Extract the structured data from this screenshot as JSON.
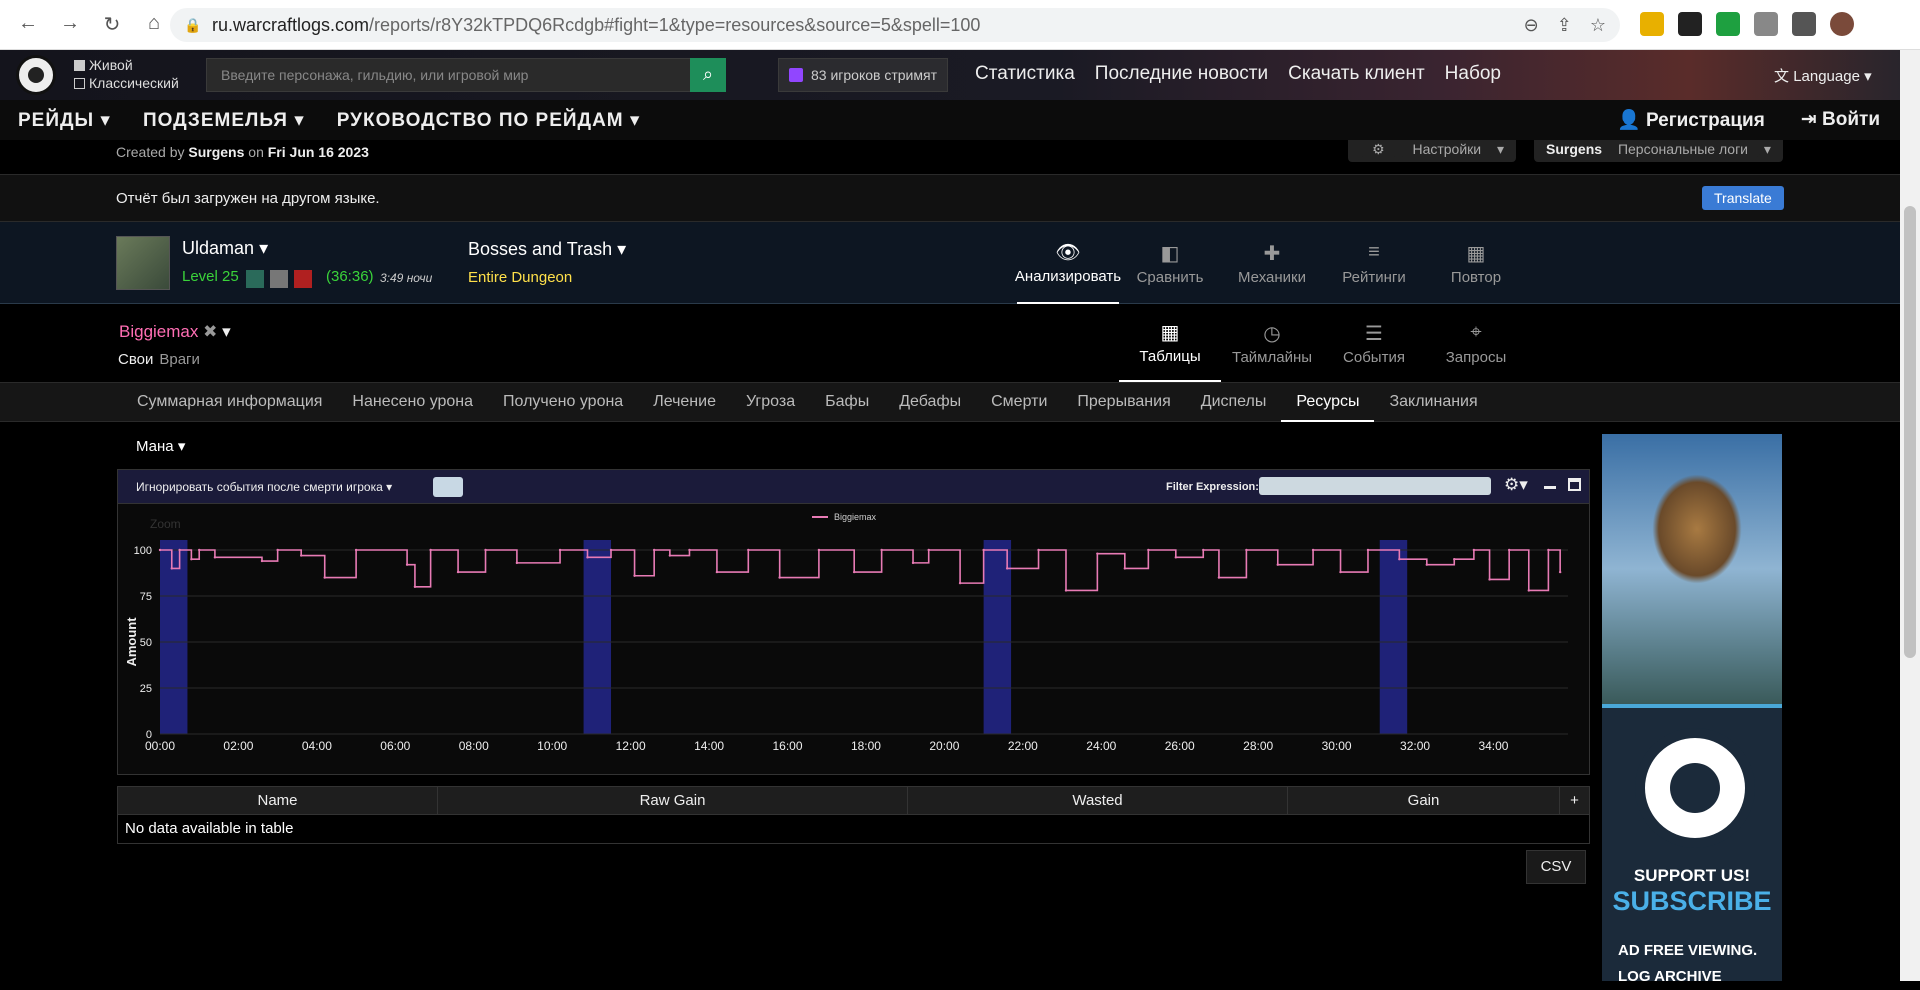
{
  "browser": {
    "url_host": "ru.warcraftlogs.com",
    "url_path": "/reports/r8Y32kTPDQ6Rcdgb#fight=1&type=resources&source=5&spell=100"
  },
  "site": {
    "mode_live": "Живой",
    "mode_classic": "Классический",
    "search_placeholder": "Введите персонажа, гильдию, или игровой мир",
    "streams": "83 игроков стримят",
    "links": [
      "Статистика",
      "Последние новости",
      "Скачать клиент",
      "Набор"
    ],
    "language": "Language"
  },
  "nav": {
    "raids": "РЕЙДЫ",
    "dungeons": "ПОДЗЕМЕЛЬЯ",
    "raid_guide": "РУКОВОДСТВО ПО РЕЙДАМ",
    "register": "Регистрация",
    "login": "Войти"
  },
  "report": {
    "created_prefix": "Created by",
    "created_by": "Surgens",
    "created_on": "on",
    "created_date": "Fri Jun 16 2023",
    "settings": "Настройки",
    "owner": "Surgens",
    "personal_logs": "Персональные логи",
    "notice": "Отчёт был загружен на другом языке.",
    "translate": "Translate"
  },
  "fight": {
    "zone": "Uldaman",
    "level": "Level 25",
    "timer": "(36:36)",
    "time_of_day": "3:49 ночи",
    "boss": "Bosses and Trash",
    "dungeon": "Entire Dungeon",
    "view_tabs": [
      "Анализировать",
      "Сравнить",
      "Механики",
      "Рейтинги",
      "Повтор"
    ]
  },
  "player": {
    "name": "Biggiemax",
    "friendly": "Свои",
    "enemies": "Враги",
    "tabs": [
      "Таблицы",
      "Таймлайны",
      "События",
      "Запросы"
    ]
  },
  "subnav": [
    "Суммарная информация",
    "Нанесено урона",
    "Получено урона",
    "Лечение",
    "Угроза",
    "Бафы",
    "Дебафы",
    "Смерти",
    "Прерывания",
    "Диспелы",
    "Ресурсы",
    "Заклинания"
  ],
  "resource": "Мана",
  "chart_panel": {
    "ignore_label": "Игнорировать события после смерти игрока",
    "filter_label": "Filter Expression:",
    "zoom": "Zoom"
  },
  "chart_data": {
    "type": "line",
    "ylabel": "Amount",
    "yticks": [
      0,
      25,
      50,
      75,
      100
    ],
    "ylim": [
      0,
      100
    ],
    "xticks": [
      "00:00",
      "02:00",
      "04:00",
      "06:00",
      "08:00",
      "10:00",
      "12:00",
      "14:00",
      "16:00",
      "18:00",
      "20:00",
      "22:00",
      "24:00",
      "26:00",
      "28:00",
      "30:00",
      "32:00",
      "34:00"
    ],
    "xlim_minutes": [
      0,
      35.9
    ],
    "series": [
      {
        "name": "Biggiemax",
        "color": "#e87bb5",
        "x_minutes": [
          0.0,
          0.3,
          0.5,
          0.8,
          1.0,
          1.4,
          2.6,
          3.0,
          3.6,
          4.2,
          5.0,
          6.3,
          6.5,
          6.9,
          7.6,
          8.3,
          9.1,
          10.2,
          10.9,
          11.5,
          12.1,
          12.6,
          13.0,
          13.5,
          14.2,
          15.0,
          15.8,
          16.8,
          17.7,
          18.4,
          19.2,
          19.6,
          20.4,
          21.0,
          21.6,
          22.4,
          23.1,
          23.9,
          24.6,
          25.2,
          25.9,
          26.6,
          27.0,
          27.7,
          28.5,
          29.4,
          30.1,
          30.8,
          31.6,
          32.3,
          33.0,
          33.5,
          33.9,
          34.4,
          34.9,
          35.4,
          35.7
        ],
        "y": [
          100,
          90,
          100,
          95,
          100,
          96,
          94,
          100,
          97,
          85,
          100,
          92,
          80,
          100,
          88,
          100,
          93,
          100,
          96,
          100,
          86,
          100,
          97,
          100,
          88,
          100,
          85,
          100,
          88,
          100,
          93,
          100,
          82,
          100,
          90,
          100,
          78,
          98,
          90,
          100,
          96,
          100,
          85,
          100,
          92,
          100,
          88,
          100,
          95,
          92,
          95,
          100,
          84,
          100,
          78,
          100,
          88
        ]
      }
    ],
    "bands_minutes": [
      [
        0.0,
        0.7
      ],
      [
        10.8,
        11.5
      ],
      [
        21.0,
        21.7
      ],
      [
        31.1,
        31.8
      ]
    ],
    "band_color": "#1f2278"
  },
  "table": {
    "columns": [
      "Name",
      "Raw Gain",
      "Wasted",
      "Gain",
      "+"
    ],
    "empty": "No data available in table",
    "csv": "CSV"
  },
  "ad": {
    "support": "SUPPORT US!",
    "subscribe": "SUBSCRIBE",
    "line1": "AD FREE VIEWING.",
    "line2": "LOG ARCHIVE"
  }
}
